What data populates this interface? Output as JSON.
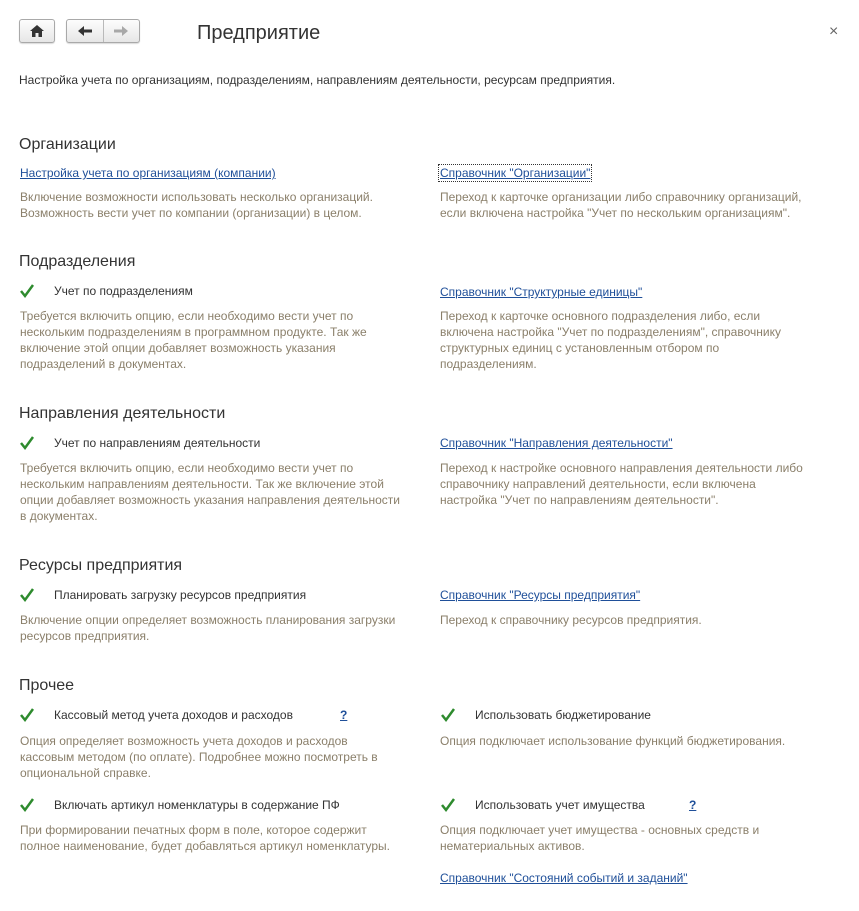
{
  "window": {
    "title": "Предприятие",
    "close_glyph": "×",
    "home_icon": "home-icon",
    "back_icon": "arrow-left-icon",
    "forward_icon": "arrow-right-icon"
  },
  "intro": "Настройка учета по организациям, подразделениям, направлениям деятельности, ресурсам предприятия.",
  "colors": {
    "link": "#1f4f99",
    "hint": "#8a7f6a",
    "check": "#2e8b2e"
  },
  "sections": {
    "organizations": {
      "title": "Организации",
      "left_link": "Настройка учета по организациям (компании)",
      "left_desc": "Включение возможности использовать несколько организаций.\nВозможность вести учет по компании (организации) в целом.",
      "right_link": "Справочник \"Организации\"",
      "right_desc": "Переход к карточке организации либо справочнику организаций,\nесли включена настройка \"Учет по нескольким организациям\"."
    },
    "departments": {
      "title": "Подразделения",
      "check_label": "Учет по подразделениям",
      "checked": true,
      "left_desc": "Требуется включить опцию, если необходимо вести учет по\nнескольким подразделениям в программном продукте. Так же\nвключение этой опции добавляет возможность указания\nподразделений в документах.",
      "right_link": "Справочник \"Структурные единицы\"",
      "right_desc": "Переход к карточке основного подразделения либо, если\nвключена настройка \"Учет по подразделениям\", справочнику\nструктурных единиц с установленным отбором по\nподразделениям."
    },
    "activities": {
      "title": "Направления деятельности",
      "check_label": "Учет по направлениям деятельности",
      "checked": true,
      "left_desc": "Требуется включить опцию, если необходимо вести учет по\nнескольким направлениям деятельности. Так же включение этой\nопции добавляет возможность указания направления деятельности\nв документах.",
      "right_link": "Справочник \"Направления деятельности\"",
      "right_desc": "Переход к настройке основного направления деятельности либо\nсправочнику направлений деятельности, если включена\nнастройка \"Учет по направлениям деятельности\"."
    },
    "resources": {
      "title": "Ресурсы предприятия",
      "check_label": "Планировать загрузку ресурсов предприятия",
      "checked": true,
      "left_desc": "Включение опции определяет возможность планирования загрузки\nресурсов предприятия.",
      "right_link": "Справочник \"Ресурсы предприятия\"",
      "right_desc": "Переход к справочнику ресурсов предприятия."
    },
    "other": {
      "title": "Прочее",
      "cash_label": "Кассовый метод учета доходов и расходов",
      "cash_help": "?",
      "cash_checked": true,
      "cash_desc": "Опция определяет возможность учета доходов и расходов\nкассовым методом (по оплате). Подробнее можно посмотреть в\nопциональной справке.",
      "budget_label": "Использовать бюджетирование",
      "budget_checked": true,
      "budget_desc": "Опция подключает использование функций бюджетирования.",
      "article_label": "Включать артикул номенклатуры в содержание ПФ",
      "article_checked": true,
      "article_desc": "При формировании печатных форм в поле, которое содержит\nполное наименование, будет добавляться артикул номенклатуры.",
      "property_label": "Использовать учет имущества",
      "property_help": "?",
      "property_checked": true,
      "property_desc": "Опция подключает учет имущества - основных средств и\nнематериальных активов.",
      "states_link": "Справочник \"Состояний событий и заданий\""
    }
  }
}
